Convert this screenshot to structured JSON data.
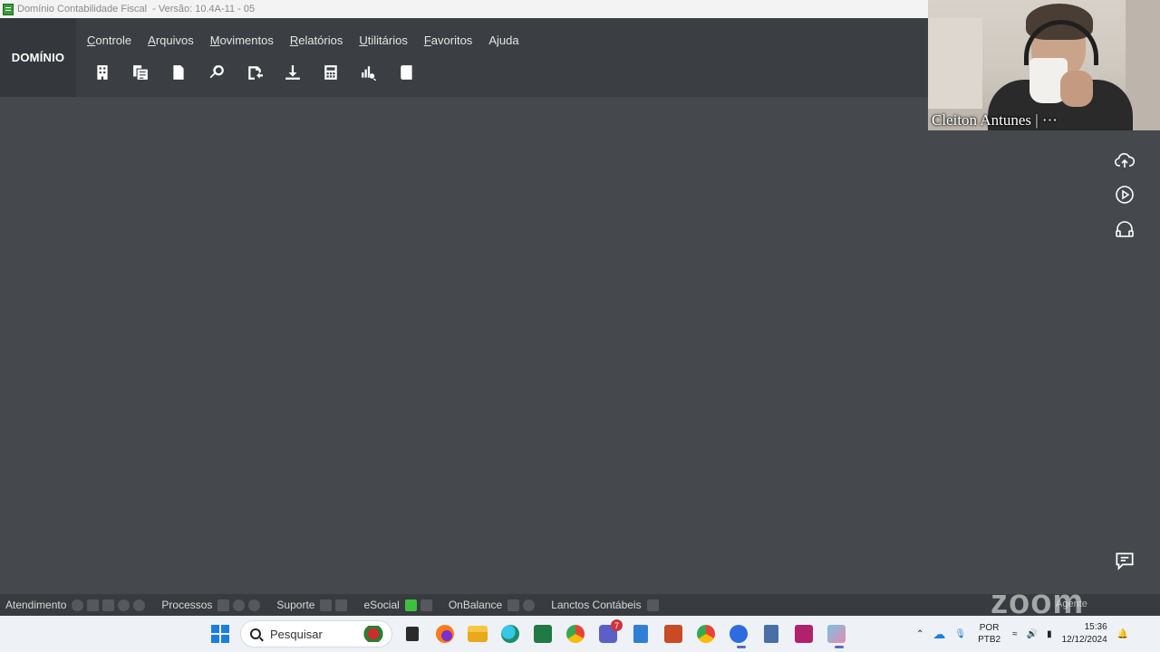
{
  "window": {
    "title": "Domínio Contabilidade Fiscal  - Versão: 10.4A-11 - 05"
  },
  "brand": "DOMÍNIO",
  "menu": [
    {
      "pre": "",
      "u": "C",
      "post": "ontrole"
    },
    {
      "pre": "",
      "u": "A",
      "post": "rquivos"
    },
    {
      "pre": "",
      "u": "M",
      "post": "ovimentos"
    },
    {
      "pre": "",
      "u": "R",
      "post": "elatórios"
    },
    {
      "pre": "",
      "u": "U",
      "post": "tilitários"
    },
    {
      "pre": "",
      "u": "F",
      "post": "avoritos"
    },
    {
      "pre": "A",
      "u": "j",
      "post": "uda"
    }
  ],
  "toolbar": [
    "building-icon",
    "copy-docs-icon",
    "document-icon",
    "search-icon",
    "transfer-icon",
    "download-icon",
    "calculator-icon",
    "chart-search-icon",
    "book-icon"
  ],
  "video": {
    "participant_name": "Cleiton Antunes | ···"
  },
  "side_icons": [
    "cloud-upload-icon",
    "play-icon",
    "headset-icon"
  ],
  "statusbar": {
    "atendimento": "Atendimento",
    "processos": "Processos",
    "suporte": "Suporte",
    "esocial": "eSocial",
    "onbalance": "OnBalance",
    "lanctos": "Lanctos Contábeis",
    "zoom_watermark": "zoom",
    "agente": "Agente"
  },
  "taskbar": {
    "search_placeholder": "Pesquisar",
    "teams_badge": "7",
    "lang_top": "POR",
    "lang_bottom": "PTB2",
    "time": "15:36",
    "date": "12/12/2024"
  },
  "colors": {
    "workspace": "#45484c",
    "header": "#3b3e42",
    "statusbar": "#383b3f",
    "esocial_indicator": "#3ec13e",
    "taskbar": "#eef1f5"
  }
}
